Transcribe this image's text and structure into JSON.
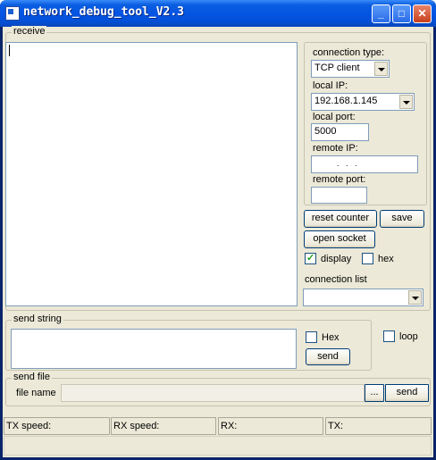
{
  "window": {
    "title": "network_debug_tool_V2.3"
  },
  "titlebar_buttons": {
    "minimize": "_",
    "maximize": "□",
    "close": "✕"
  },
  "receive": {
    "group_label": "receive",
    "textarea_value": "",
    "connection_type_label": "connection type:",
    "connection_type_value": "TCP client",
    "local_ip_label": "local IP:",
    "local_ip_value": "192.168.1.145",
    "local_port_label": "local port:",
    "local_port_value": "5000",
    "remote_ip_label": "remote IP:",
    "remote_ip_value": ".   .   .",
    "remote_port_label": "remote port:",
    "remote_port_value": "",
    "reset_counter_label": "reset counter",
    "save_label": "save",
    "open_socket_label": "open socket",
    "display_label": "display",
    "display_checked": true,
    "hex_label": "hex",
    "hex_checked": false,
    "connection_list_label": "connection list",
    "connection_list_value": ""
  },
  "send_string": {
    "group_label": "send string",
    "textarea_value": "",
    "hex_label": "Hex",
    "hex_checked": false,
    "send_label": "send",
    "loop_label": "loop",
    "loop_checked": false
  },
  "send_file": {
    "group_label": "send file",
    "file_name_label": "file name",
    "file_name_value": "",
    "browse_label": "...",
    "send_label": "send"
  },
  "status_bar": {
    "tx_speed": "TX speed:",
    "rx_speed": "RX speed:",
    "rx": "RX:",
    "tx": "TX:"
  }
}
